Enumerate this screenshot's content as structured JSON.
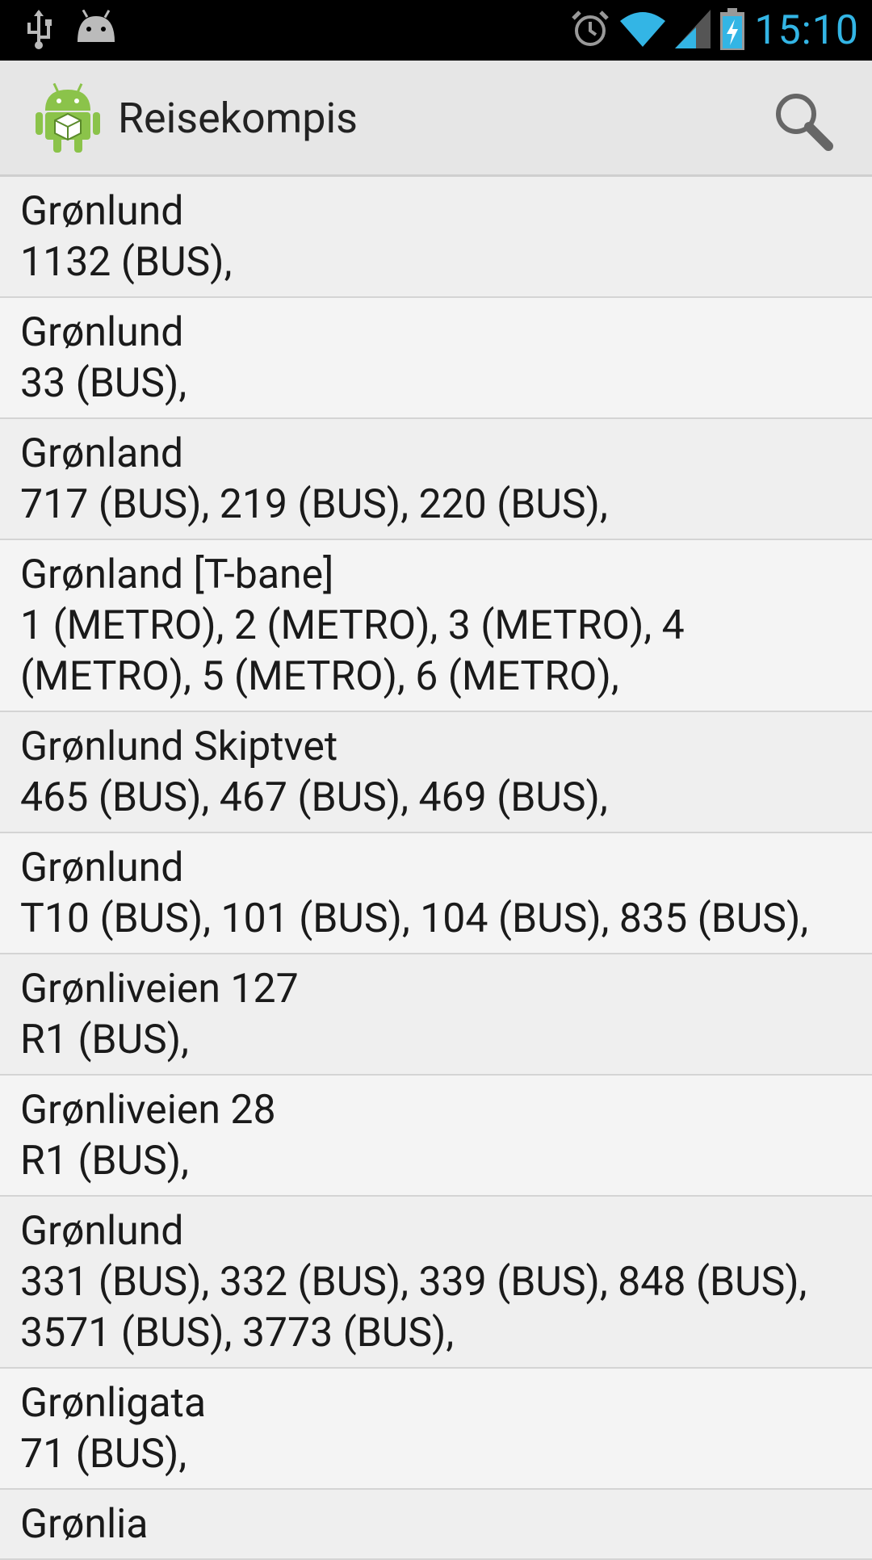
{
  "status_bar": {
    "time": "15:10",
    "icons": [
      "usb-icon",
      "android-debug-icon",
      "alarm-icon",
      "wifi-icon",
      "cell-signal-icon",
      "battery-charging-icon"
    ]
  },
  "action_bar": {
    "title": "Reisekompis",
    "icon": "android-app-icon",
    "search_icon": "search-icon"
  },
  "stops": [
    {
      "name": "Grønlund",
      "routes": "1132 (BUS),"
    },
    {
      "name": "Grønlund",
      "routes": "33 (BUS),"
    },
    {
      "name": "Grønland",
      "routes": "717 (BUS), 219 (BUS), 220 (BUS),"
    },
    {
      "name": "Grønland [T-bane]",
      "routes": "1 (METRO), 2 (METRO), 3 (METRO), 4 (METRO), 5 (METRO), 6 (METRO),"
    },
    {
      "name": "Grønlund Skiptvet",
      "routes": "465 (BUS), 467 (BUS), 469 (BUS),"
    },
    {
      "name": "Grønlund",
      "routes": "T10 (BUS), 101 (BUS), 104 (BUS), 835 (BUS),"
    },
    {
      "name": "Grønliveien 127",
      "routes": "R1 (BUS),"
    },
    {
      "name": "Grønliveien 28",
      "routes": "R1 (BUS),"
    },
    {
      "name": "Grønlund",
      "routes": "331 (BUS), 332 (BUS), 339 (BUS), 848 (BUS), 3571 (BUS), 3773 (BUS),"
    },
    {
      "name": "Grønligata",
      "routes": "71 (BUS),"
    },
    {
      "name": "Grønlia",
      "routes": ""
    }
  ]
}
